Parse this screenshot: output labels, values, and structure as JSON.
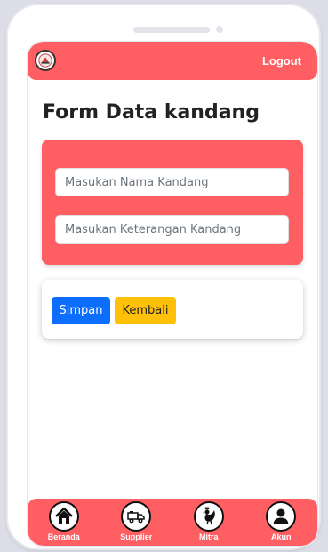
{
  "header": {
    "logo_icon": "farm-logo-icon",
    "logout_label": "Logout"
  },
  "page": {
    "title": "Form Data kandang"
  },
  "form": {
    "name_placeholder": "Masukan Nama Kandang",
    "name_value": "",
    "description_placeholder": "Masukan Keterangan Kandang",
    "description_value": ""
  },
  "actions": {
    "save_label": "Simpan",
    "back_label": "Kembali"
  },
  "nav": {
    "items": [
      {
        "label": "Beranda",
        "icon": "home-icon"
      },
      {
        "label": "Supplier",
        "icon": "truck-icon"
      },
      {
        "label": "Mitra",
        "icon": "rooster-icon"
      },
      {
        "label": "Akun",
        "icon": "user-icon"
      }
    ]
  },
  "colors": {
    "accent": "#ff5e62",
    "primary_button": "#0d6efd",
    "warning_button": "#ffc107"
  }
}
